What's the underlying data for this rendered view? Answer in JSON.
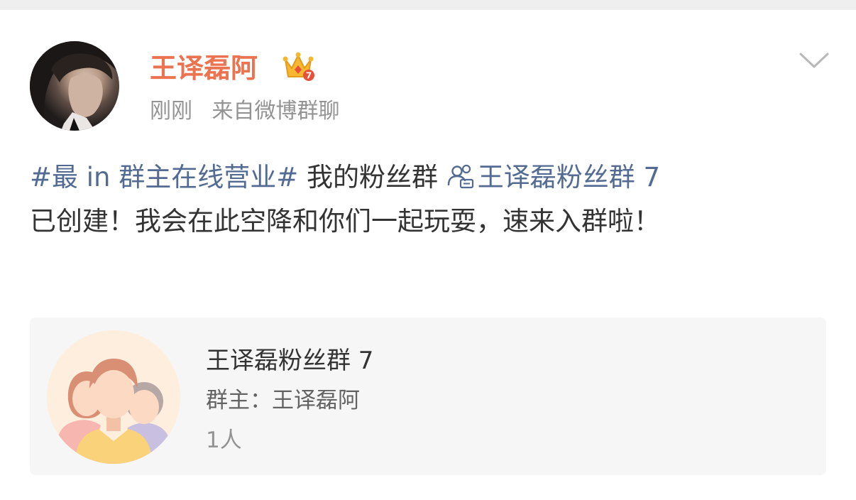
{
  "post": {
    "author": {
      "name": "王译磊阿",
      "avatar_icon": "user-avatar-photo",
      "badge_icon": "vip-crown-icon",
      "badge_level": "7"
    },
    "time": "刚刚",
    "source": "来自微博群聊",
    "more_icon": "chevron-down-icon",
    "content": {
      "hashtag": "#最 in 群主在线营业#",
      "text1": " 我的粉丝群 ",
      "group_link": "王译磊粉丝群 7",
      "group_link_icon": "group-chat-icon",
      "text2": "已创建！我会在此空降和你们一起玩耍，速来入群啦！"
    },
    "group_card": {
      "icon": "group-members-icon",
      "name": "王译磊粉丝群 7",
      "owner": "群主：王译磊阿",
      "members": "1人"
    }
  },
  "colors": {
    "username": "#eb7350",
    "link": "#536b92",
    "meta": "#939393",
    "text": "#333333",
    "card_bg": "#f6f6f6"
  }
}
